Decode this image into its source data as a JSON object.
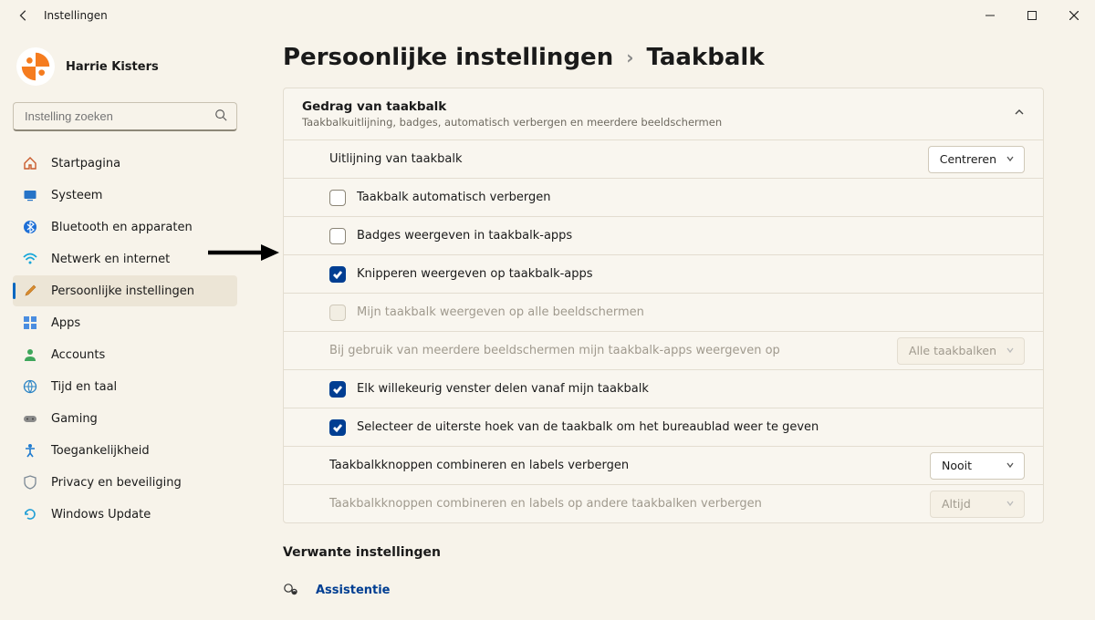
{
  "app_title": "Instellingen",
  "user_name": "Harrie Kisters",
  "search": {
    "placeholder": "Instelling zoeken"
  },
  "sidebar": {
    "items": [
      {
        "label": "Startpagina",
        "icon": "home"
      },
      {
        "label": "Systeem",
        "icon": "system"
      },
      {
        "label": "Bluetooth en apparaten",
        "icon": "bluetooth"
      },
      {
        "label": "Netwerk en internet",
        "icon": "network"
      },
      {
        "label": "Persoonlijke instellingen",
        "icon": "personalize",
        "selected": true
      },
      {
        "label": "Apps",
        "icon": "apps"
      },
      {
        "label": "Accounts",
        "icon": "accounts"
      },
      {
        "label": "Tijd en taal",
        "icon": "time"
      },
      {
        "label": "Gaming",
        "icon": "gaming"
      },
      {
        "label": "Toegankelijkheid",
        "icon": "accessibility"
      },
      {
        "label": "Privacy en beveiliging",
        "icon": "privacy"
      },
      {
        "label": "Windows Update",
        "icon": "update"
      }
    ]
  },
  "breadcrumb": {
    "parent": "Persoonlijke instellingen",
    "current": "Taakbalk"
  },
  "group": {
    "title": "Gedrag van taakbalk",
    "subtitle": "Taakbalkuitlijning, badges, automatisch verbergen en meerdere beeldschermen"
  },
  "rows": {
    "alignment": {
      "label": "Uitlijning van taakbalk",
      "value": "Centreren"
    },
    "auto_hide": {
      "label": "Taakbalk automatisch verbergen",
      "checked": false
    },
    "badges": {
      "label": "Badges weergeven in taakbalk-apps",
      "checked": false
    },
    "flash": {
      "label": "Knipperen weergeven op taakbalk-apps",
      "checked": true
    },
    "all_displays": {
      "label": "Mijn taakbalk weergeven op alle beeldschermen",
      "checked": false,
      "disabled": true
    },
    "multi_apps": {
      "label": "Bij gebruik van meerdere beeldschermen mijn taakbalk-apps weergeven op",
      "value": "Alle taakbalken",
      "disabled": true
    },
    "share_window": {
      "label": "Elk willekeurig venster delen vanaf mijn taakbalk",
      "checked": true
    },
    "desktop_corner": {
      "label": "Selecteer de uiterste hoek van de taakbalk om het bureaublad weer te geven",
      "checked": true
    },
    "combine": {
      "label": "Taakbalkknoppen combineren en labels verbergen",
      "value": "Nooit"
    },
    "combine_other": {
      "label": "Taakbalkknoppen combineren en labels op andere taakbalken verbergen",
      "value": "Altijd",
      "disabled": true
    }
  },
  "related": {
    "title": "Verwante instellingen",
    "assist": "Assistentie"
  }
}
